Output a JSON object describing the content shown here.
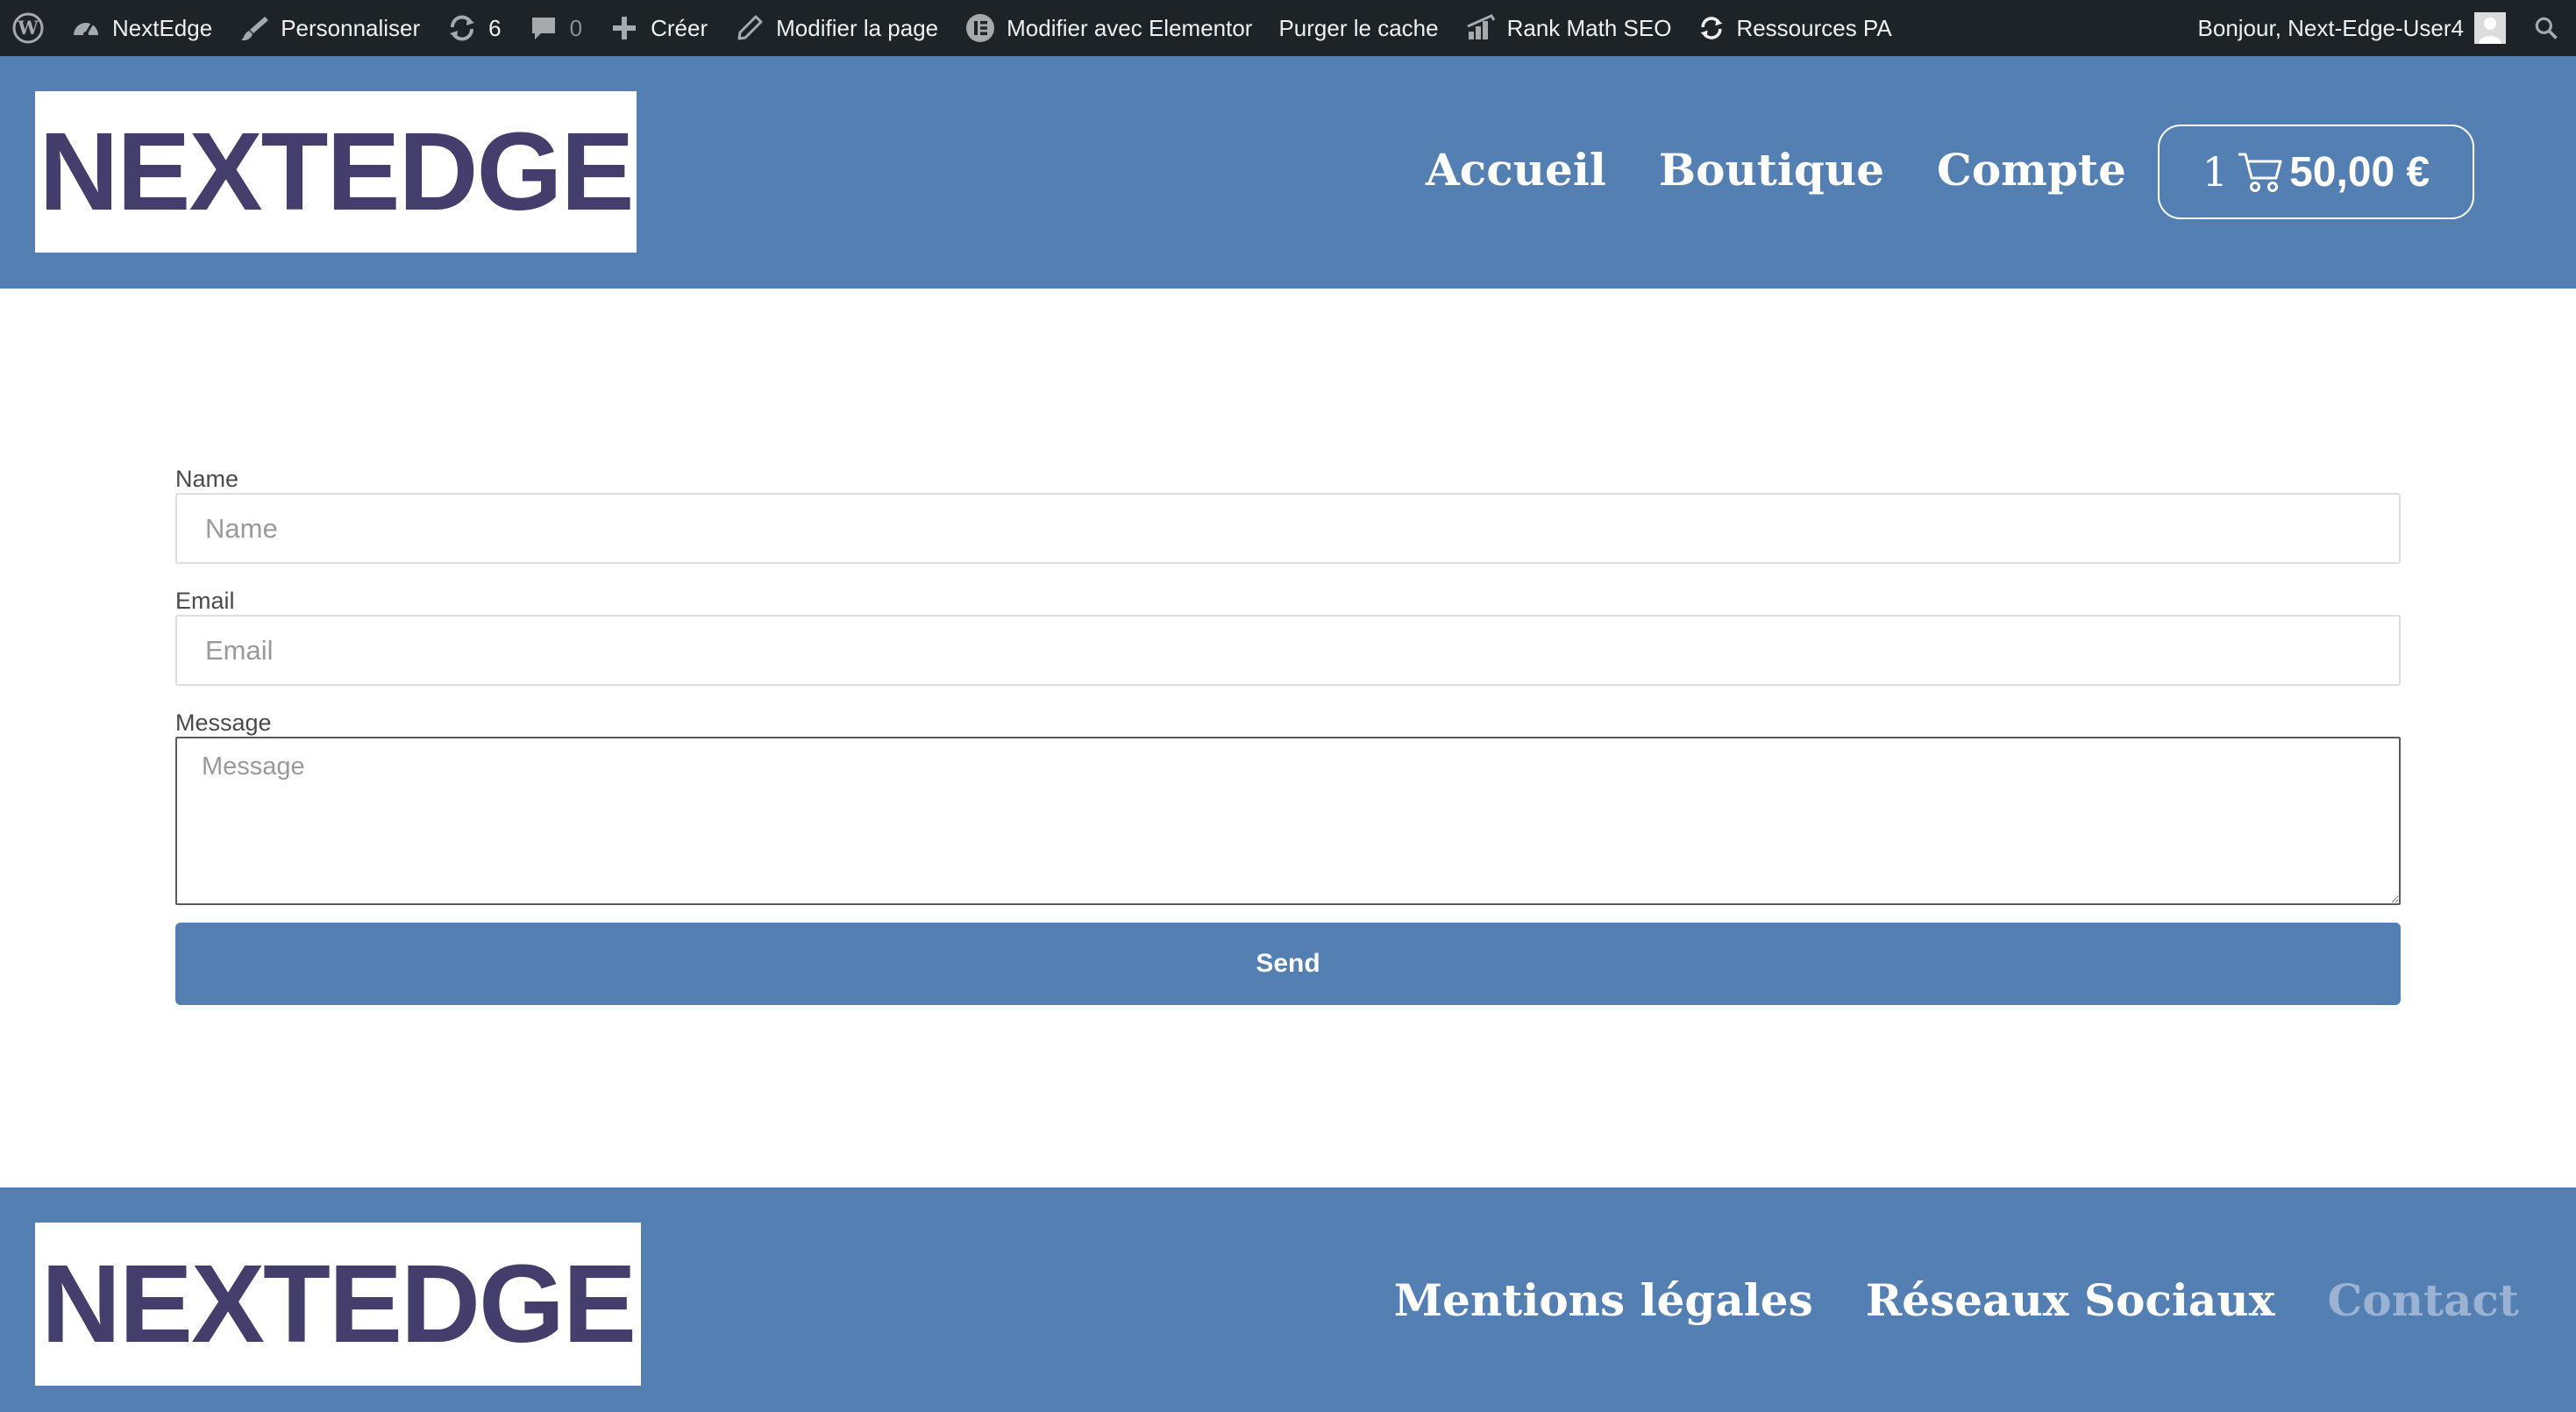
{
  "admin_bar": {
    "site_name": "NextEdge",
    "customize": "Personnaliser",
    "updates_count": "6",
    "comments_count": "0",
    "new": "Créer",
    "edit_page": "Modifier la page",
    "edit_elementor": "Modifier avec Elementor",
    "purge_cache": "Purger le cache",
    "rank_math": "Rank Math SEO",
    "pa_resources": "Ressources PA",
    "greeting": "Bonjour, Next-Edge-User4"
  },
  "header": {
    "logo": "NEXTEDGE",
    "nav": [
      "Accueil",
      "Boutique",
      "Compte"
    ],
    "cart": {
      "count": "1",
      "total": "50,00 €"
    }
  },
  "form": {
    "name_label": "Name",
    "name_placeholder": "Name",
    "email_label": "Email",
    "email_placeholder": "Email",
    "message_label": "Message",
    "message_placeholder": "Message",
    "send_label": "Send"
  },
  "footer": {
    "logo": "NEXTEDGE",
    "links": [
      "Mentions légales",
      "Réseaux Sociaux",
      "Contact"
    ],
    "current_link": "Contact"
  },
  "colors": {
    "admin_bar_bg": "#1d2327",
    "brand_blue": "#537fb3",
    "logo_text": "#443e6d",
    "inactive_link": "#9bb2d3"
  },
  "icons": {
    "wordpress": "wordpress-icon",
    "dashboard": "dashboard-icon",
    "brush": "brush-icon",
    "updates": "updates-icon",
    "comments": "comments-icon",
    "plus": "plus-icon",
    "pencil": "pencil-icon",
    "elementor": "elementor-icon",
    "rank_math": "rank-math-icon",
    "refresh": "refresh-icon",
    "search": "search-icon",
    "cart": "cart-icon"
  }
}
